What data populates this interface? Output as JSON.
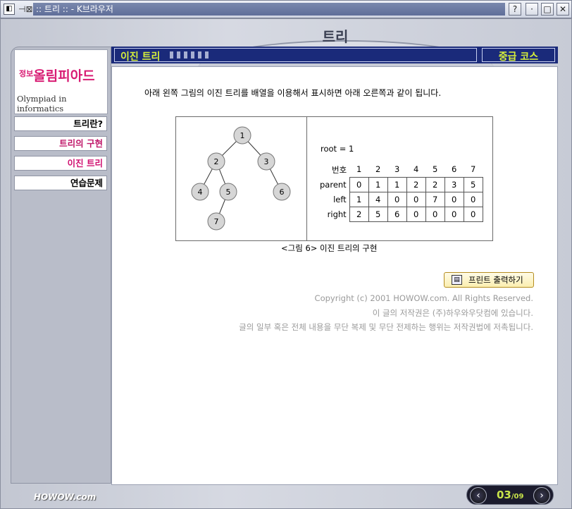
{
  "window": {
    "title": ":: 트리 :: - K브라우저",
    "help_label": "?",
    "pin_glyph": "⊣⊠",
    "min_glyph": "·",
    "max_glyph": "□",
    "close_glyph": "✕"
  },
  "page": {
    "heading": "트리",
    "section_title": "이진 트리",
    "course_label": "중급 코스"
  },
  "logo": {
    "kr_small": "정보",
    "kr_main": "올림피아드",
    "en": "Olympiad in informatics"
  },
  "menu": [
    {
      "label": "트리란?"
    },
    {
      "label": "트리의 구현"
    },
    {
      "label": "이진 트리"
    },
    {
      "label": "연습문제"
    }
  ],
  "content": {
    "intro": "아래 왼쪽 그림의 이진 트리를 배열을 이용해서 표시하면 아래 오른쪽과 같이 됩니다.",
    "caption": "<그림 6> 이진 트리의 구현",
    "tree_nodes": [
      "1",
      "2",
      "3",
      "4",
      "5",
      "6",
      "7"
    ],
    "root_text": "root = 1",
    "table": {
      "index_label": "번호",
      "columns": [
        "1",
        "2",
        "3",
        "4",
        "5",
        "6",
        "7"
      ],
      "rows": [
        {
          "label": "parent",
          "values": [
            "0",
            "1",
            "1",
            "2",
            "2",
            "3",
            "5"
          ]
        },
        {
          "label": "left",
          "values": [
            "1",
            "4",
            "0",
            "0",
            "7",
            "0",
            "0"
          ]
        },
        {
          "label": "right",
          "values": [
            "2",
            "5",
            "6",
            "0",
            "0",
            "0",
            "0"
          ]
        }
      ]
    },
    "print_label": "프린트 출력하기",
    "copyright": [
      "Copyright (c) 2001 HOWOW.com. All Rights Reserved.",
      "이 글의 저작권은 (주)하우와우닷컴에 있습니다.",
      "글의 일부 혹은 전체 내용을 무단 복제 및 무단 전제하는 행위는 저작권법에 저촉됩니다."
    ]
  },
  "footer": {
    "brand": "HOWOW.com",
    "page_current": "03",
    "page_total": "/09",
    "prev_glyph": "‹",
    "next_glyph": "›"
  },
  "colors": {
    "header_bg": "#1a2a7a",
    "header_text": "#d7f03a",
    "menu_accent": "#d01070",
    "tree_node_fill": "#d6d6d6"
  }
}
